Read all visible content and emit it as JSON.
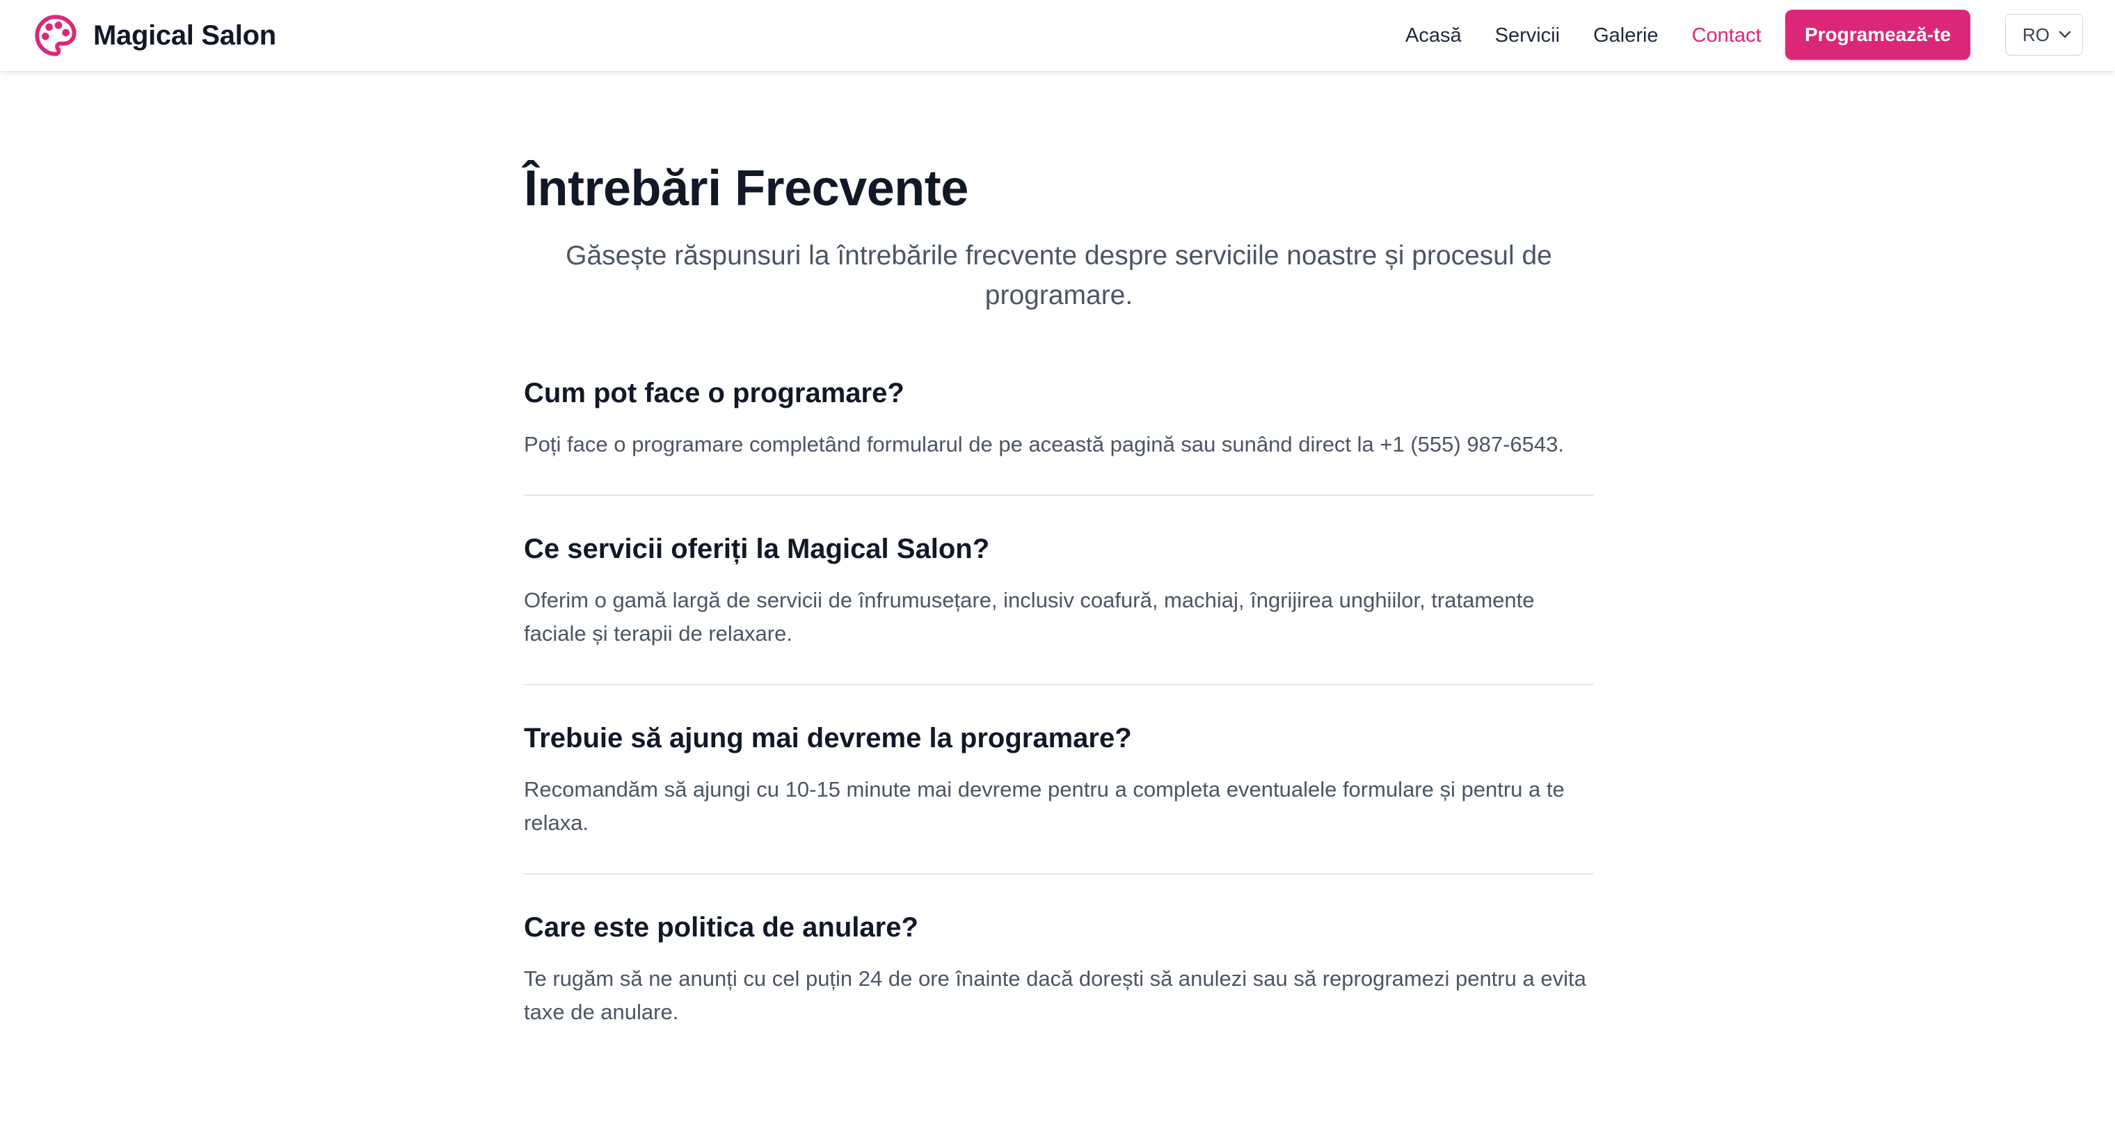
{
  "brand": {
    "name": "Magical Salon",
    "accent_color": "#db2777",
    "logo_icon": "palette-icon"
  },
  "nav": {
    "links": [
      {
        "label": "Acasă",
        "active": false
      },
      {
        "label": "Servicii",
        "active": false
      },
      {
        "label": "Galerie",
        "active": false
      },
      {
        "label": "Contact",
        "active": true
      }
    ],
    "cta_label": "Programează-te",
    "language": "RO"
  },
  "faq": {
    "title": "Întrebări Frecvente",
    "subtitle": "Găsește răspunsuri la întrebările frecvente despre serviciile noastre și procesul de programare.",
    "items": [
      {
        "question": "Cum pot face o programare?",
        "answer": "Poți face o programare completând formularul de pe această pagină sau sunând direct la +1 (555) 987-6543."
      },
      {
        "question": "Ce servicii oferiți la Magical Salon?",
        "answer": "Oferim o gamă largă de servicii de înfrumusețare, inclusiv coafură, machiaj, îngrijirea unghiilor, tratamente faciale și terapii de relaxare."
      },
      {
        "question": "Trebuie să ajung mai devreme la programare?",
        "answer": "Recomandăm să ajungi cu 10-15 minute mai devreme pentru a completa eventualele formulare și pentru a te relaxa."
      },
      {
        "question": "Care este politica de anulare?",
        "answer": "Te rugăm să ne anunți cu cel puțin 24 de ore înainte dacă dorești să anulezi sau să reprogramezi pentru a evita taxe de anulare."
      }
    ]
  }
}
